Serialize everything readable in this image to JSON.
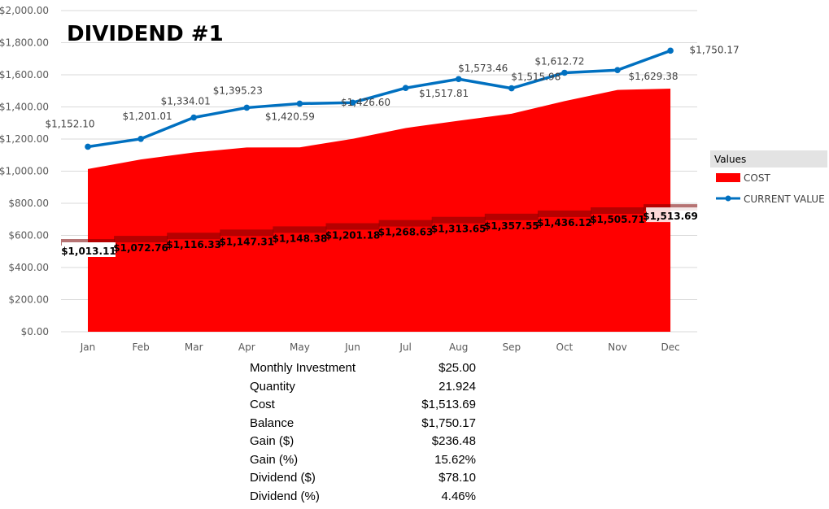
{
  "chart_data": {
    "type": "area+line",
    "title": "DIVIDEND #1",
    "categories": [
      "Jan",
      "Feb",
      "Mar",
      "Apr",
      "May",
      "Jun",
      "Jul",
      "Aug",
      "Sep",
      "Oct",
      "Nov",
      "Dec"
    ],
    "ylim": [
      0,
      2000
    ],
    "yticks": [
      0,
      200,
      400,
      600,
      800,
      1000,
      1200,
      1400,
      1600,
      1800,
      2000
    ],
    "ytick_labels": [
      "$0.00",
      "$200.00",
      "$400.00",
      "$600.00",
      "$800.00",
      "$1,000.00",
      "$1,200.00",
      "$1,400.00",
      "$1,600.00",
      "$1,800.00",
      "$2,000.00"
    ],
    "grid": true,
    "legend_position": "right",
    "legend_title": "Values",
    "series": [
      {
        "name": "COST",
        "type": "area",
        "color": "#ff0000",
        "values": [
          1013.11,
          1072.76,
          1116.33,
          1147.31,
          1148.38,
          1201.18,
          1268.63,
          1313.65,
          1357.55,
          1436.12,
          1505.71,
          1513.69
        ],
        "labels": [
          "$1,013.11",
          "$1,072.76",
          "$1,116.33",
          "$1,147.31",
          "$1,148.38",
          "$1,201.18",
          "$1,268.63",
          "$1,313.65",
          "$1,357.55",
          "$1,436.12",
          "$1,505.71",
          "$1,513.69"
        ]
      },
      {
        "name": "CURRENT VALUE",
        "type": "line",
        "color": "#0070c0",
        "values": [
          1152.1,
          1201.01,
          1334.01,
          1395.23,
          1420.59,
          1426.6,
          1517.81,
          1573.46,
          1515.98,
          1612.72,
          1629.38,
          1750.17
        ],
        "labels": [
          "$1,152.10",
          "$1,201.01",
          "$1,334.01",
          "$1,395.23",
          "$1,420.59",
          "$1,426.60",
          "$1,517.81",
          "$1,573.46",
          "$1,515.98",
          "$1,612.72",
          "$1,629.38",
          "$1,750.17"
        ]
      }
    ]
  },
  "summary": [
    {
      "label": "Monthly Investment",
      "value": "$25.00"
    },
    {
      "label": "Quantity",
      "value": "21.924"
    },
    {
      "label": "Cost",
      "value": "$1,513.69"
    },
    {
      "label": "Balance",
      "value": "$1,750.17"
    },
    {
      "label": "Gain ($)",
      "value": "$236.48"
    },
    {
      "label": "Gain (%)",
      "value": "15.62%"
    },
    {
      "label": "Dividend ($)",
      "value": "$78.10"
    },
    {
      "label": "Dividend (%)",
      "value": "4.46%"
    }
  ]
}
